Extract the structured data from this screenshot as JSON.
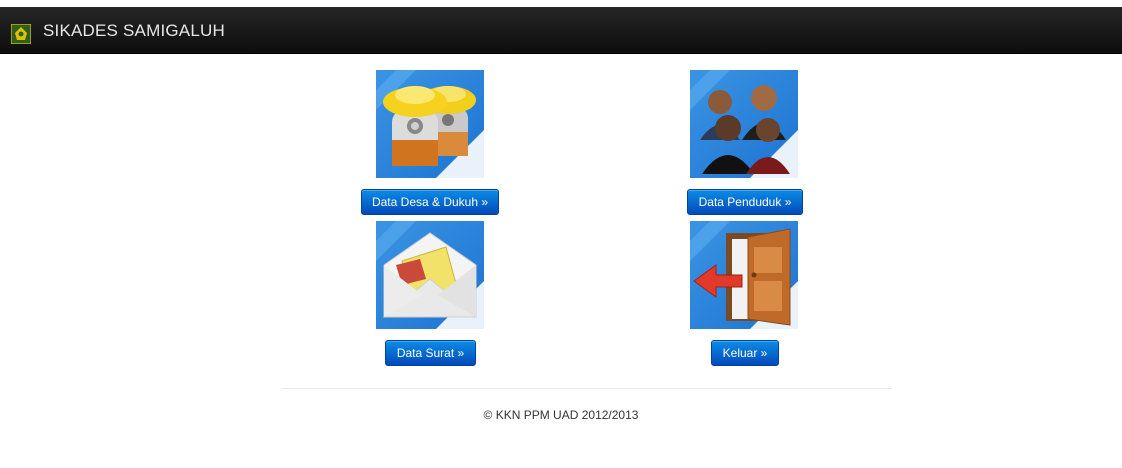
{
  "navbar": {
    "brand": "SIKADES SAMIGALUH",
    "logo_icon": "village-emblem-icon"
  },
  "menu": [
    {
      "label": "Data Desa & Dukuh »",
      "icon": "village-huts-icon"
    },
    {
      "label": "Data Penduduk »",
      "icon": "people-group-icon"
    },
    {
      "label": "Data Surat »",
      "icon": "envelope-letter-icon"
    },
    {
      "label": "Keluar »",
      "icon": "exit-door-icon"
    }
  ],
  "footer": {
    "text": "© KKN PPM UAD 2012/2013"
  },
  "colors": {
    "navbar": "#1b1b1b",
    "button": "#0a6fd4",
    "tile": "#2a86e0"
  }
}
